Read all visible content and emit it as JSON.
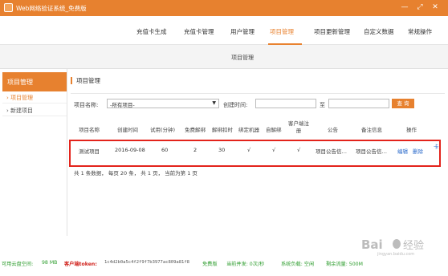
{
  "window": {
    "title": "Web网络验证系统_免费版",
    "controls": {
      "minimize": "—",
      "maximize": "⤢",
      "close": "✕"
    }
  },
  "nav": {
    "items": [
      {
        "label": "充值卡生成",
        "active": false
      },
      {
        "label": "充值卡管理",
        "active": false
      },
      {
        "label": "用户管理",
        "active": false
      },
      {
        "label": "项目管理",
        "active": true
      },
      {
        "label": "项目更新管理",
        "active": false
      },
      {
        "label": "自定义数据",
        "active": false
      },
      {
        "label": "常规操作",
        "active": false
      }
    ],
    "accent_color": "#e8822f"
  },
  "breadcrumb": {
    "label": "项目管理"
  },
  "sidebar": {
    "header": "项目管理",
    "items": [
      {
        "label": "› 项目管理",
        "active": true
      },
      {
        "label": "› 新建项目",
        "active": false
      }
    ]
  },
  "main": {
    "title": "项目管理",
    "filter": {
      "project_label": "项目名称:",
      "project_selected": "-所有项目-",
      "created_label": "创建时间:",
      "to_label": "至",
      "query_button": "查 询"
    },
    "table": {
      "headers": [
        "项目名称",
        "创建时间",
        "试用(分钟)",
        "免费解绑",
        "解绑扣时",
        "绑定机器",
        "自解绑",
        "客户端注册",
        "公告",
        "备注信息",
        "操作"
      ],
      "rows": [
        {
          "name": "测试项目",
          "created": "2016-09-08",
          "trial": "60",
          "free_unbind": "2",
          "unbind_deduct": "30",
          "bind_machine": "√",
          "self_unbind": "√",
          "client_register": "√",
          "notice": "项目公告信…",
          "remark": "项目公告信…",
          "edit": "编辑",
          "delete": "删除"
        }
      ],
      "corner_text": "卡"
    },
    "pager": "共 1 条数据， 每页 20 条， 共 1 页， 当前为第 1 页"
  },
  "statusbar": {
    "cloud_label": "可用云盘空间:",
    "cloud_value": "98 MB",
    "token_label": "客户端token:",
    "token_value": "1c4d2b0a5c4f2f9f7b3977ac809a81f8",
    "plan": "免费版",
    "concurrency": "当前并发: 0次/秒",
    "load": "系统负载: 空闲",
    "traffic": "剩余流量: 500M",
    "colors": {
      "green": "#2e9d2e",
      "red": "#d0211b"
    }
  },
  "watermark": {
    "brand": "Bai",
    "brand2": "经验",
    "sub": "jingyan.baidu.com"
  }
}
